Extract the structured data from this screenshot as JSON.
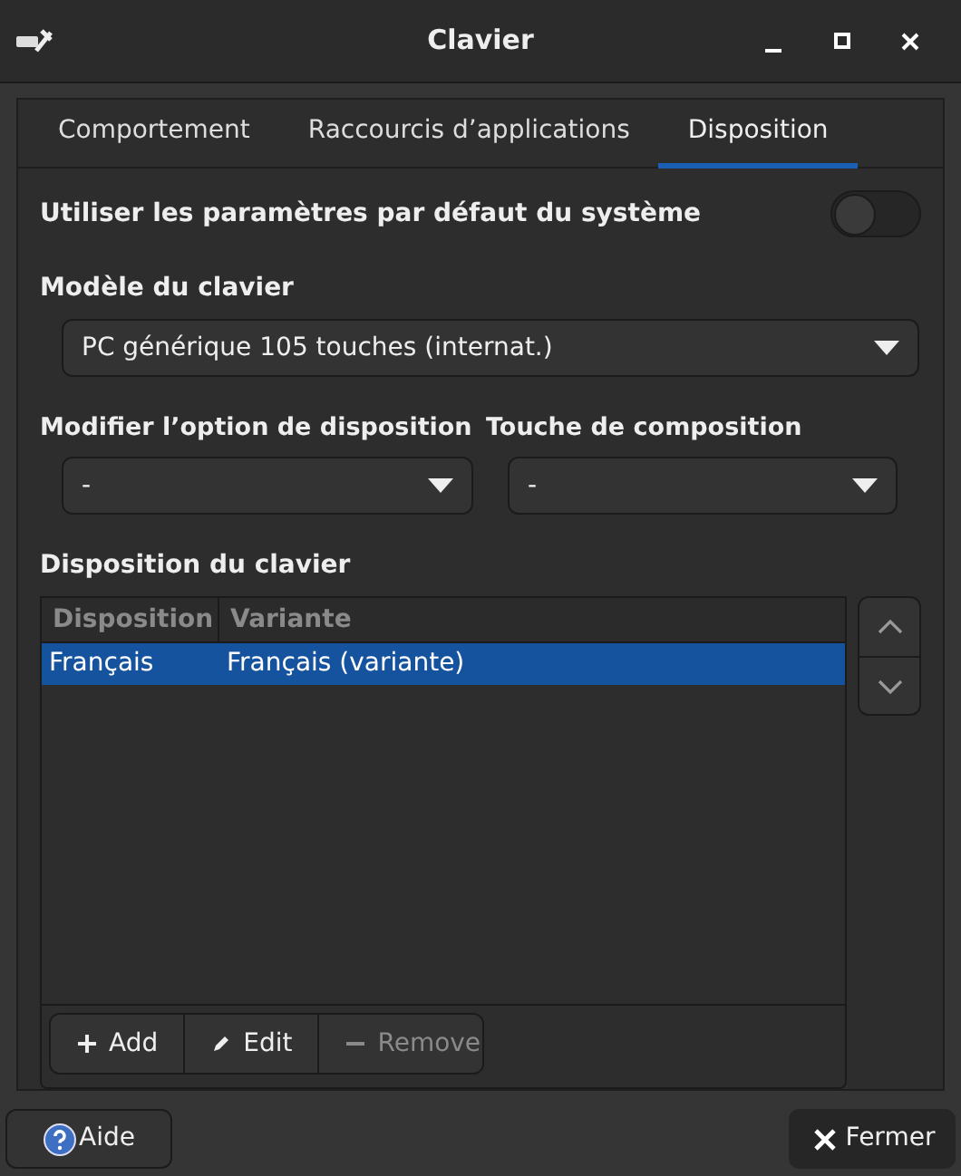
{
  "window": {
    "title": "Clavier"
  },
  "tabs": [
    {
      "label": "Comportement",
      "selected": false
    },
    {
      "label": "Raccourcis d’applications",
      "selected": false
    },
    {
      "label": "Disposition",
      "selected": true
    }
  ],
  "use_system_defaults": {
    "label": "Utiliser les paramètres par défaut du système",
    "on": false
  },
  "keyboard_model": {
    "label": "Modèle du clavier",
    "value": "PC générique 105 touches (internat.)"
  },
  "layout_option": {
    "label": "Modifier l’option de disposition",
    "value": "-"
  },
  "compose_key": {
    "label": "Touche de composition",
    "value": "-"
  },
  "layouts": {
    "label": "Disposition du clavier",
    "columns": [
      "Disposition",
      "Variante"
    ],
    "rows": [
      {
        "cells": [
          "Français",
          "Français (variante)"
        ],
        "selected": true
      }
    ]
  },
  "layout_buttons": [
    {
      "label": "Add",
      "kind": "add",
      "disabled": false
    },
    {
      "label": "Edit",
      "kind": "edit",
      "disabled": false
    },
    {
      "label": "Remove",
      "kind": "remove",
      "disabled": true
    }
  ],
  "buttons": [
    {
      "label": "Aide",
      "kind": "help",
      "hovered": false
    },
    {
      "label": "Fermer",
      "kind": "close",
      "hovered": true
    }
  ]
}
